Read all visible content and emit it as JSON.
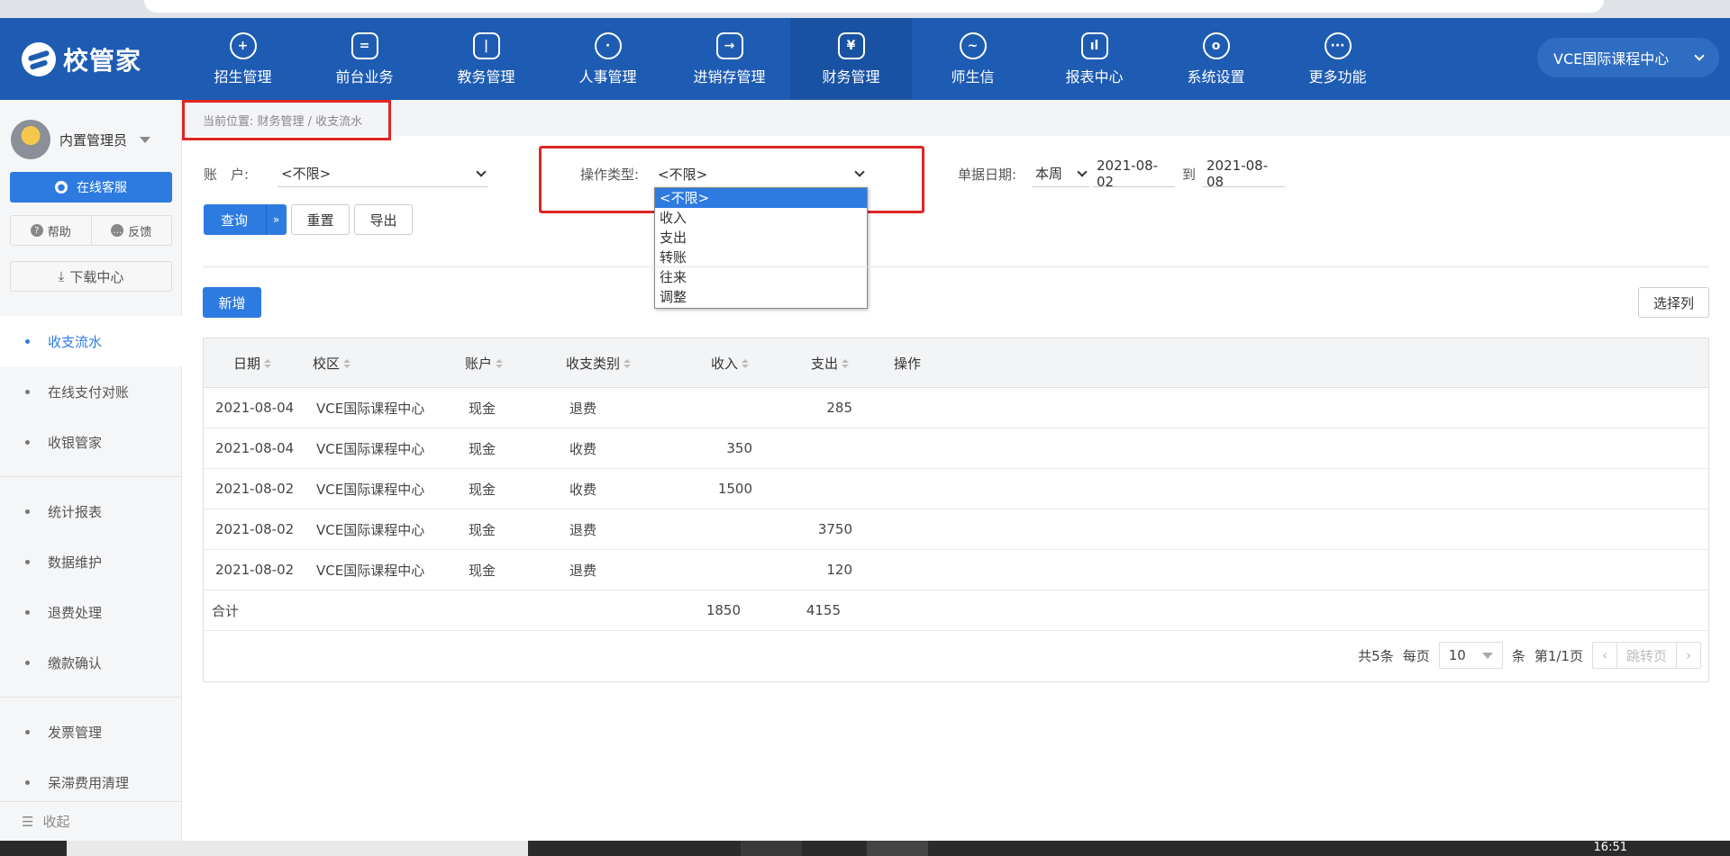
{
  "nav": {
    "logo_text": "校管家",
    "items": [
      {
        "label": "招生管理",
        "icon": "user-plus-icon"
      },
      {
        "label": "前台业务",
        "icon": "screen-icon"
      },
      {
        "label": "教务管理",
        "icon": "book-icon"
      },
      {
        "label": "人事管理",
        "icon": "person-icon"
      },
      {
        "label": "进销存管理",
        "icon": "box-arrow-icon"
      },
      {
        "label": "财务管理",
        "icon": "yen-house-icon"
      },
      {
        "label": "师生信",
        "icon": "chat-icon"
      },
      {
        "label": "报表中心",
        "icon": "bar-chart-icon"
      },
      {
        "label": "系统设置",
        "icon": "gear-icon"
      },
      {
        "label": "更多功能",
        "icon": "more-icon"
      }
    ],
    "active_index": 5,
    "campus": "VCE国际课程中心"
  },
  "sidebar": {
    "user_name": "内置管理员",
    "online_service": "在线客服",
    "help": "帮助",
    "feedback": "反馈",
    "download": "下载中心",
    "menu_group1": [
      "收支流水",
      "在线支付对账",
      "收银管家"
    ],
    "menu_group2": [
      "统计报表",
      "数据维护",
      "退费处理",
      "缴款确认"
    ],
    "menu_group3": [
      "发票管理",
      "呆滞费用清理"
    ],
    "active_item": "收支流水",
    "collapse": "收起"
  },
  "breadcrumb": "当前位置:  财务管理 / 收支流水",
  "filters": {
    "account_label": "账　户:",
    "account_value": "<不限>",
    "op_type_label": "操作类型:",
    "op_type_value": "<不限>",
    "op_type_options": [
      "<不限>",
      "收入",
      "支出",
      "转账",
      "往来",
      "调整"
    ],
    "date_label": "单据日期:",
    "date_range_type": "本周",
    "date_from": "2021-08-02",
    "date_to_label": "到",
    "date_to": "2021-08-08"
  },
  "buttons": {
    "query": "查询",
    "reset": "重置",
    "export": "导出",
    "add": "新增",
    "choose_columns": "选择列"
  },
  "table": {
    "headers": [
      "日期",
      "校区",
      "账户",
      "收支类别",
      "收入",
      "支出",
      "操作"
    ],
    "rows": [
      [
        "2021-08-04",
        "VCE国际课程中心",
        "现金",
        "退费",
        "",
        "285"
      ],
      [
        "2021-08-04",
        "VCE国际课程中心",
        "现金",
        "收费",
        "350",
        ""
      ],
      [
        "2021-08-02",
        "VCE国际课程中心",
        "现金",
        "收费",
        "1500",
        ""
      ],
      [
        "2021-08-02",
        "VCE国际课程中心",
        "现金",
        "退费",
        "",
        "3750"
      ],
      [
        "2021-08-02",
        "VCE国际课程中心",
        "现金",
        "退费",
        "",
        "120"
      ]
    ],
    "total_label": "合计",
    "total_in": "1850",
    "total_out": "4155"
  },
  "pager": {
    "total": "共5条",
    "per_page_label": "每页",
    "per_page": "10",
    "unit": "条",
    "page_info": "第1/1页",
    "jump": "跳转页"
  },
  "taskbar": {
    "time": "16:51"
  },
  "colors": {
    "nav_bg": "#1e5cb3",
    "primary": "#2d7be0",
    "highlight_box": "#e02525"
  }
}
